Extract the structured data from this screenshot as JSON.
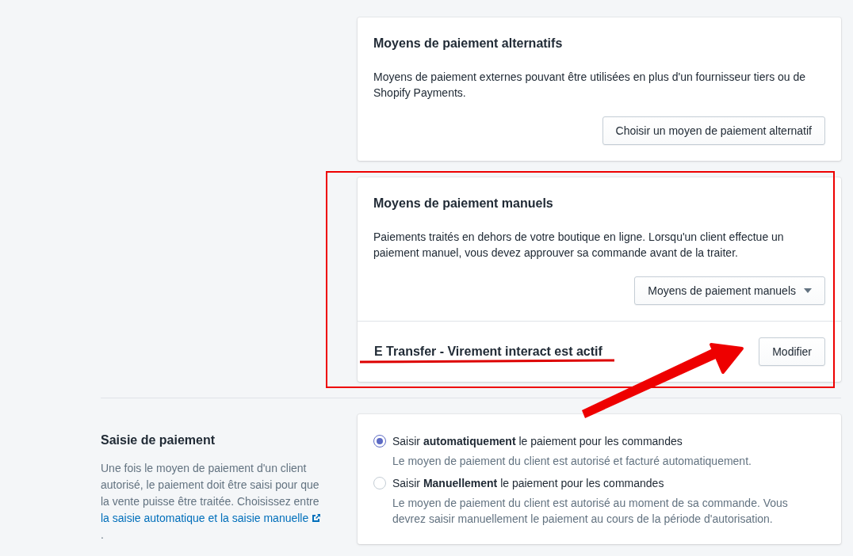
{
  "cards": [
    {
      "title": "Moyens de paiement alternatifs",
      "description": "Moyens de paiement externes pouvant être utilisées en plus d'un fournisseur tiers ou de Shopify Payments.",
      "button": {
        "label": "Choisir un moyen de paiement alternatif",
        "kind": "plain"
      }
    },
    {
      "title": "Moyens de paiement manuels",
      "description": "Paiements traités en dehors de votre boutique en ligne. Lorsqu'un client effectue un paiement manuel, vous devez approuver sa commande avant de la traiter.",
      "button": {
        "label": "Moyens de paiement manuels",
        "kind": "dropdown"
      },
      "footer": {
        "status": "E Transfer - Virement interact est actif",
        "button": "Modifier"
      }
    }
  ],
  "capture": {
    "title": "Saisie de paiement",
    "description": "Une fois le moyen de paiement d'un client autorisé, le paiement doit être saisi pour que la vente puisse être traitée. Choisissez entre ",
    "link": "la saisie automatique et la saisie manuelle",
    "description_end": " .",
    "options": [
      {
        "label": "Saisir **automatiquement** le paiement pour les commandes",
        "hint": "Le moyen de paiement du client est autorisé et facturé automatiquement.",
        "selected": true
      },
      {
        "label": "Saisir **Manuellement** le paiement pour les commandes",
        "hint": "Le moyen de paiement du client est autorisé au moment de sa commande. Vous devrez saisir manuellement le paiement au cours de la période d'autorisation.",
        "selected": false
      }
    ]
  }
}
